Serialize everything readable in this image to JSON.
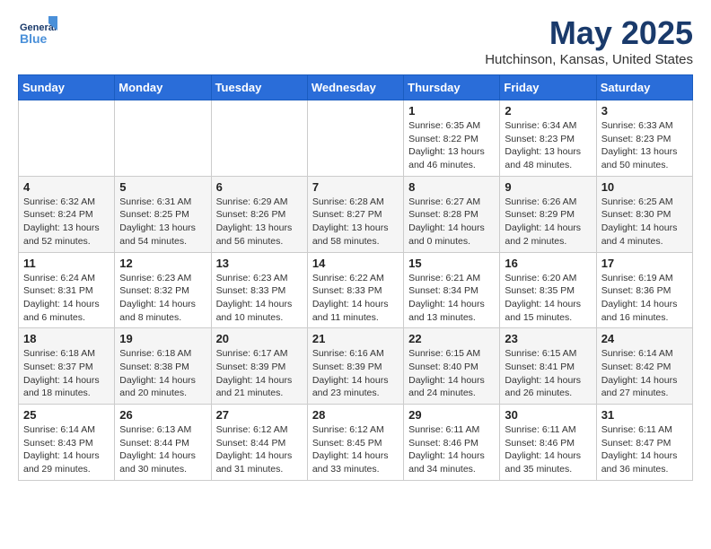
{
  "header": {
    "logo_line1": "General",
    "logo_line2": "Blue",
    "month": "May 2025",
    "location": "Hutchinson, Kansas, United States"
  },
  "days_of_week": [
    "Sunday",
    "Monday",
    "Tuesday",
    "Wednesday",
    "Thursday",
    "Friday",
    "Saturday"
  ],
  "weeks": [
    [
      {
        "day": "",
        "info": ""
      },
      {
        "day": "",
        "info": ""
      },
      {
        "day": "",
        "info": ""
      },
      {
        "day": "",
        "info": ""
      },
      {
        "day": "1",
        "info": "Sunrise: 6:35 AM\nSunset: 8:22 PM\nDaylight: 13 hours\nand 46 minutes."
      },
      {
        "day": "2",
        "info": "Sunrise: 6:34 AM\nSunset: 8:23 PM\nDaylight: 13 hours\nand 48 minutes."
      },
      {
        "day": "3",
        "info": "Sunrise: 6:33 AM\nSunset: 8:23 PM\nDaylight: 13 hours\nand 50 minutes."
      }
    ],
    [
      {
        "day": "4",
        "info": "Sunrise: 6:32 AM\nSunset: 8:24 PM\nDaylight: 13 hours\nand 52 minutes."
      },
      {
        "day": "5",
        "info": "Sunrise: 6:31 AM\nSunset: 8:25 PM\nDaylight: 13 hours\nand 54 minutes."
      },
      {
        "day": "6",
        "info": "Sunrise: 6:29 AM\nSunset: 8:26 PM\nDaylight: 13 hours\nand 56 minutes."
      },
      {
        "day": "7",
        "info": "Sunrise: 6:28 AM\nSunset: 8:27 PM\nDaylight: 13 hours\nand 58 minutes."
      },
      {
        "day": "8",
        "info": "Sunrise: 6:27 AM\nSunset: 8:28 PM\nDaylight: 14 hours\nand 0 minutes."
      },
      {
        "day": "9",
        "info": "Sunrise: 6:26 AM\nSunset: 8:29 PM\nDaylight: 14 hours\nand 2 minutes."
      },
      {
        "day": "10",
        "info": "Sunrise: 6:25 AM\nSunset: 8:30 PM\nDaylight: 14 hours\nand 4 minutes."
      }
    ],
    [
      {
        "day": "11",
        "info": "Sunrise: 6:24 AM\nSunset: 8:31 PM\nDaylight: 14 hours\nand 6 minutes."
      },
      {
        "day": "12",
        "info": "Sunrise: 6:23 AM\nSunset: 8:32 PM\nDaylight: 14 hours\nand 8 minutes."
      },
      {
        "day": "13",
        "info": "Sunrise: 6:23 AM\nSunset: 8:33 PM\nDaylight: 14 hours\nand 10 minutes."
      },
      {
        "day": "14",
        "info": "Sunrise: 6:22 AM\nSunset: 8:33 PM\nDaylight: 14 hours\nand 11 minutes."
      },
      {
        "day": "15",
        "info": "Sunrise: 6:21 AM\nSunset: 8:34 PM\nDaylight: 14 hours\nand 13 minutes."
      },
      {
        "day": "16",
        "info": "Sunrise: 6:20 AM\nSunset: 8:35 PM\nDaylight: 14 hours\nand 15 minutes."
      },
      {
        "day": "17",
        "info": "Sunrise: 6:19 AM\nSunset: 8:36 PM\nDaylight: 14 hours\nand 16 minutes."
      }
    ],
    [
      {
        "day": "18",
        "info": "Sunrise: 6:18 AM\nSunset: 8:37 PM\nDaylight: 14 hours\nand 18 minutes."
      },
      {
        "day": "19",
        "info": "Sunrise: 6:18 AM\nSunset: 8:38 PM\nDaylight: 14 hours\nand 20 minutes."
      },
      {
        "day": "20",
        "info": "Sunrise: 6:17 AM\nSunset: 8:39 PM\nDaylight: 14 hours\nand 21 minutes."
      },
      {
        "day": "21",
        "info": "Sunrise: 6:16 AM\nSunset: 8:39 PM\nDaylight: 14 hours\nand 23 minutes."
      },
      {
        "day": "22",
        "info": "Sunrise: 6:15 AM\nSunset: 8:40 PM\nDaylight: 14 hours\nand 24 minutes."
      },
      {
        "day": "23",
        "info": "Sunrise: 6:15 AM\nSunset: 8:41 PM\nDaylight: 14 hours\nand 26 minutes."
      },
      {
        "day": "24",
        "info": "Sunrise: 6:14 AM\nSunset: 8:42 PM\nDaylight: 14 hours\nand 27 minutes."
      }
    ],
    [
      {
        "day": "25",
        "info": "Sunrise: 6:14 AM\nSunset: 8:43 PM\nDaylight: 14 hours\nand 29 minutes."
      },
      {
        "day": "26",
        "info": "Sunrise: 6:13 AM\nSunset: 8:44 PM\nDaylight: 14 hours\nand 30 minutes."
      },
      {
        "day": "27",
        "info": "Sunrise: 6:12 AM\nSunset: 8:44 PM\nDaylight: 14 hours\nand 31 minutes."
      },
      {
        "day": "28",
        "info": "Sunrise: 6:12 AM\nSunset: 8:45 PM\nDaylight: 14 hours\nand 33 minutes."
      },
      {
        "day": "29",
        "info": "Sunrise: 6:11 AM\nSunset: 8:46 PM\nDaylight: 14 hours\nand 34 minutes."
      },
      {
        "day": "30",
        "info": "Sunrise: 6:11 AM\nSunset: 8:46 PM\nDaylight: 14 hours\nand 35 minutes."
      },
      {
        "day": "31",
        "info": "Sunrise: 6:11 AM\nSunset: 8:47 PM\nDaylight: 14 hours\nand 36 minutes."
      }
    ]
  ]
}
